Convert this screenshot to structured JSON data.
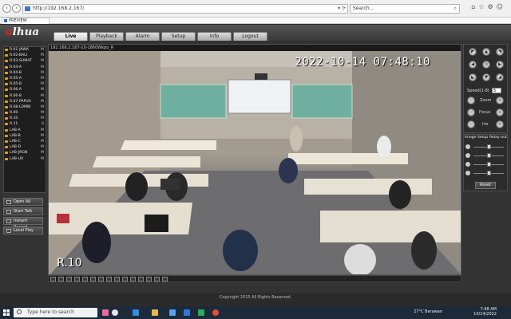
{
  "browser": {
    "url": "http://192.168.2.167/",
    "search_placeholder": "Search...",
    "tab_label": "PREVIEW"
  },
  "app": {
    "logo_prefix": "a",
    "logo_rest": "lhua",
    "tabs": [
      {
        "label": "Live",
        "active": true
      },
      {
        "label": "Playback",
        "active": false
      },
      {
        "label": "Alarm",
        "active": false
      },
      {
        "label": "Setup",
        "active": false
      },
      {
        "label": "Info",
        "active": false
      },
      {
        "label": "Logout",
        "active": false
      }
    ]
  },
  "camera_list": [
    {
      "label": "R.01-JAWA",
      "flag": "M"
    },
    {
      "label": "R.02-BALI",
      "flag": "M"
    },
    {
      "label": "R.03-SUMAT",
      "flag": "M"
    },
    {
      "label": "R.04-A",
      "flag": "M"
    },
    {
      "label": "R.04-B",
      "flag": "M"
    },
    {
      "label": "R.05-A",
      "flag": "M"
    },
    {
      "label": "R.05-B",
      "flag": "M"
    },
    {
      "label": "R.06-A",
      "flag": "M"
    },
    {
      "label": "R.06-B",
      "flag": "M"
    },
    {
      "label": "R.07-PAPUA",
      "flag": "M"
    },
    {
      "label": "R.08-LOMBI",
      "flag": "M"
    },
    {
      "label": "R.09",
      "flag": "M"
    },
    {
      "label": "R.10",
      "flag": "M"
    },
    {
      "label": "R.11",
      "flag": "S"
    },
    {
      "label": "LAB-A",
      "flag": "M"
    },
    {
      "label": "LAB-B",
      "flag": "M"
    },
    {
      "label": "LAB-C",
      "flag": "M"
    },
    {
      "label": "LAB-D",
      "flag": "M"
    },
    {
      "label": "LAB-JRGN",
      "flag": "M"
    },
    {
      "label": "LAB-UX",
      "flag": "M"
    }
  ],
  "left_buttons": {
    "open_all": "Open All",
    "start_talk": "Start Talk",
    "instant_record": "Instant Record",
    "local_play": "Local Play"
  },
  "video": {
    "header": "192.168.2.167-10-1860Wkpo_R",
    "timestamp": "2022-10-14  07:48:10",
    "channel_name": "R.10"
  },
  "ptz": {
    "speed_label": "Speed(1-8)",
    "speed_value": "5",
    "zoom_label": "Zoom",
    "focus_label": "Focus",
    "iris_label": "Iris"
  },
  "image_setup": {
    "tab_label": "Image Setup",
    "relay_label": "Relay-out",
    "sliders": [
      {
        "icon": "brightness-icon",
        "level": 0.5
      },
      {
        "icon": "contrast-icon",
        "level": 0.5
      },
      {
        "icon": "saturation-icon",
        "level": 0.5
      },
      {
        "icon": "hue-icon",
        "level": 0.5
      }
    ],
    "reset_label": "Reset"
  },
  "footer": {
    "copyright": "Copyright 2015 All Rights Reserved."
  },
  "taskbar": {
    "search_placeholder": "Type here to search",
    "weather": "27°C  Berawan",
    "time": "7:48 AM",
    "date": "10/14/2022"
  }
}
